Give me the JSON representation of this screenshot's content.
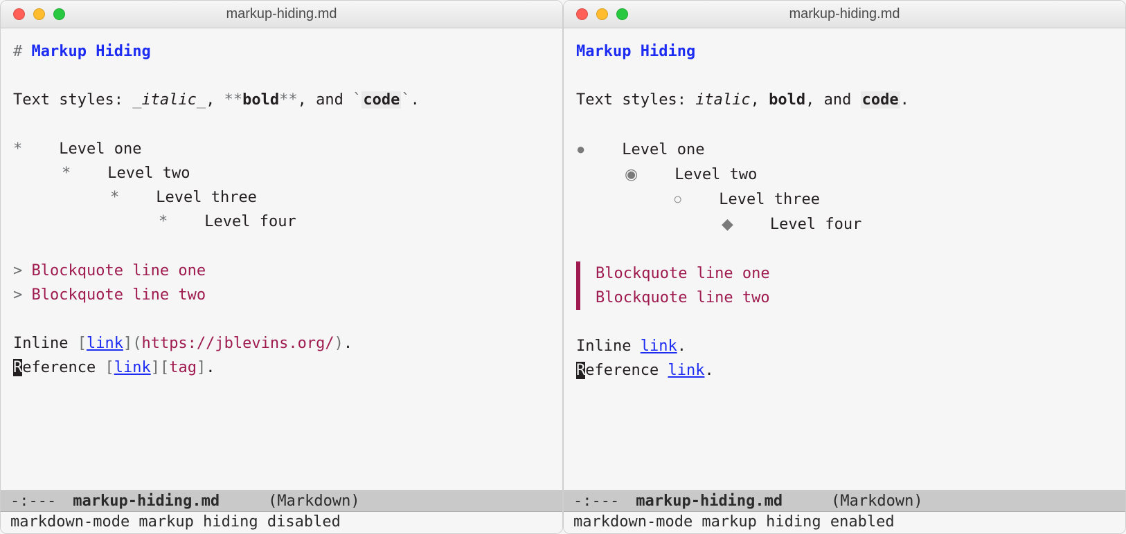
{
  "filename": "markup-hiding.md",
  "heading": "Markup Hiding",
  "textstyles_prefix": "Text styles: ",
  "italic_word": "italic",
  "bold_word": "bold",
  "code_word": "code",
  "and_word": ", and ",
  "comma": ", ",
  "period": ".",
  "list": {
    "l1": "Level one",
    "l2": "Level two",
    "l3": "Level three",
    "l4": "Level four"
  },
  "blockquote": {
    "l1": "Blockquote line one",
    "l2": "Blockquote line two"
  },
  "inline_prefix": "Inline ",
  "link_word": "link",
  "link_url": "https://jblevins.org/",
  "reference_prefix_first": "R",
  "reference_prefix_rest": "eference ",
  "ref_tag": "tag",
  "modeline": {
    "flags": "-:---",
    "file": "markup-hiding.md",
    "mode": "(Markdown)"
  },
  "echo_left": "markdown-mode markup hiding disabled",
  "echo_right": "markdown-mode markup hiding enabled",
  "markers": {
    "hash": "# ",
    "underscore": "_",
    "doublestar": "**",
    "backtick": "`",
    "star": "*",
    "gt": "> ",
    "lbr": "[",
    "rbr": "]",
    "lpar": "(",
    "rpar": ")"
  },
  "bullets": {
    "b1": "●",
    "b2": "◉",
    "b3": "○",
    "b4": "◆"
  }
}
